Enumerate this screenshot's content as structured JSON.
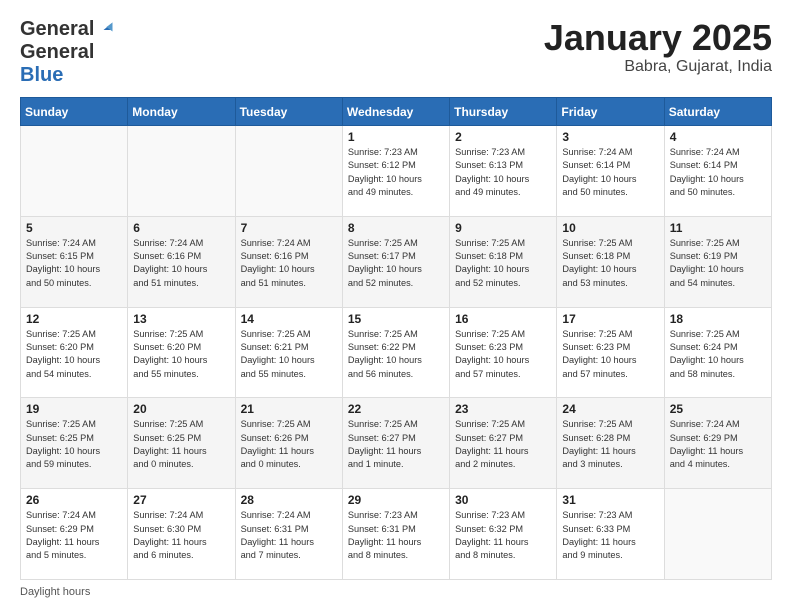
{
  "logo": {
    "general": "General",
    "blue": "Blue"
  },
  "header": {
    "month": "January 2025",
    "location": "Babra, Gujarat, India"
  },
  "weekdays": [
    "Sunday",
    "Monday",
    "Tuesday",
    "Wednesday",
    "Thursday",
    "Friday",
    "Saturday"
  ],
  "footer": {
    "label": "Daylight hours"
  },
  "weeks": [
    [
      {
        "day": "",
        "info": ""
      },
      {
        "day": "",
        "info": ""
      },
      {
        "day": "",
        "info": ""
      },
      {
        "day": "1",
        "info": "Sunrise: 7:23 AM\nSunset: 6:12 PM\nDaylight: 10 hours\nand 49 minutes."
      },
      {
        "day": "2",
        "info": "Sunrise: 7:23 AM\nSunset: 6:13 PM\nDaylight: 10 hours\nand 49 minutes."
      },
      {
        "day": "3",
        "info": "Sunrise: 7:24 AM\nSunset: 6:14 PM\nDaylight: 10 hours\nand 50 minutes."
      },
      {
        "day": "4",
        "info": "Sunrise: 7:24 AM\nSunset: 6:14 PM\nDaylight: 10 hours\nand 50 minutes."
      }
    ],
    [
      {
        "day": "5",
        "info": "Sunrise: 7:24 AM\nSunset: 6:15 PM\nDaylight: 10 hours\nand 50 minutes."
      },
      {
        "day": "6",
        "info": "Sunrise: 7:24 AM\nSunset: 6:16 PM\nDaylight: 10 hours\nand 51 minutes."
      },
      {
        "day": "7",
        "info": "Sunrise: 7:24 AM\nSunset: 6:16 PM\nDaylight: 10 hours\nand 51 minutes."
      },
      {
        "day": "8",
        "info": "Sunrise: 7:25 AM\nSunset: 6:17 PM\nDaylight: 10 hours\nand 52 minutes."
      },
      {
        "day": "9",
        "info": "Sunrise: 7:25 AM\nSunset: 6:18 PM\nDaylight: 10 hours\nand 52 minutes."
      },
      {
        "day": "10",
        "info": "Sunrise: 7:25 AM\nSunset: 6:18 PM\nDaylight: 10 hours\nand 53 minutes."
      },
      {
        "day": "11",
        "info": "Sunrise: 7:25 AM\nSunset: 6:19 PM\nDaylight: 10 hours\nand 54 minutes."
      }
    ],
    [
      {
        "day": "12",
        "info": "Sunrise: 7:25 AM\nSunset: 6:20 PM\nDaylight: 10 hours\nand 54 minutes."
      },
      {
        "day": "13",
        "info": "Sunrise: 7:25 AM\nSunset: 6:20 PM\nDaylight: 10 hours\nand 55 minutes."
      },
      {
        "day": "14",
        "info": "Sunrise: 7:25 AM\nSunset: 6:21 PM\nDaylight: 10 hours\nand 55 minutes."
      },
      {
        "day": "15",
        "info": "Sunrise: 7:25 AM\nSunset: 6:22 PM\nDaylight: 10 hours\nand 56 minutes."
      },
      {
        "day": "16",
        "info": "Sunrise: 7:25 AM\nSunset: 6:23 PM\nDaylight: 10 hours\nand 57 minutes."
      },
      {
        "day": "17",
        "info": "Sunrise: 7:25 AM\nSunset: 6:23 PM\nDaylight: 10 hours\nand 57 minutes."
      },
      {
        "day": "18",
        "info": "Sunrise: 7:25 AM\nSunset: 6:24 PM\nDaylight: 10 hours\nand 58 minutes."
      }
    ],
    [
      {
        "day": "19",
        "info": "Sunrise: 7:25 AM\nSunset: 6:25 PM\nDaylight: 10 hours\nand 59 minutes."
      },
      {
        "day": "20",
        "info": "Sunrise: 7:25 AM\nSunset: 6:25 PM\nDaylight: 11 hours\nand 0 minutes."
      },
      {
        "day": "21",
        "info": "Sunrise: 7:25 AM\nSunset: 6:26 PM\nDaylight: 11 hours\nand 0 minutes."
      },
      {
        "day": "22",
        "info": "Sunrise: 7:25 AM\nSunset: 6:27 PM\nDaylight: 11 hours\nand 1 minute."
      },
      {
        "day": "23",
        "info": "Sunrise: 7:25 AM\nSunset: 6:27 PM\nDaylight: 11 hours\nand 2 minutes."
      },
      {
        "day": "24",
        "info": "Sunrise: 7:25 AM\nSunset: 6:28 PM\nDaylight: 11 hours\nand 3 minutes."
      },
      {
        "day": "25",
        "info": "Sunrise: 7:24 AM\nSunset: 6:29 PM\nDaylight: 11 hours\nand 4 minutes."
      }
    ],
    [
      {
        "day": "26",
        "info": "Sunrise: 7:24 AM\nSunset: 6:29 PM\nDaylight: 11 hours\nand 5 minutes."
      },
      {
        "day": "27",
        "info": "Sunrise: 7:24 AM\nSunset: 6:30 PM\nDaylight: 11 hours\nand 6 minutes."
      },
      {
        "day": "28",
        "info": "Sunrise: 7:24 AM\nSunset: 6:31 PM\nDaylight: 11 hours\nand 7 minutes."
      },
      {
        "day": "29",
        "info": "Sunrise: 7:23 AM\nSunset: 6:31 PM\nDaylight: 11 hours\nand 8 minutes."
      },
      {
        "day": "30",
        "info": "Sunrise: 7:23 AM\nSunset: 6:32 PM\nDaylight: 11 hours\nand 8 minutes."
      },
      {
        "day": "31",
        "info": "Sunrise: 7:23 AM\nSunset: 6:33 PM\nDaylight: 11 hours\nand 9 minutes."
      },
      {
        "day": "",
        "info": ""
      }
    ]
  ]
}
